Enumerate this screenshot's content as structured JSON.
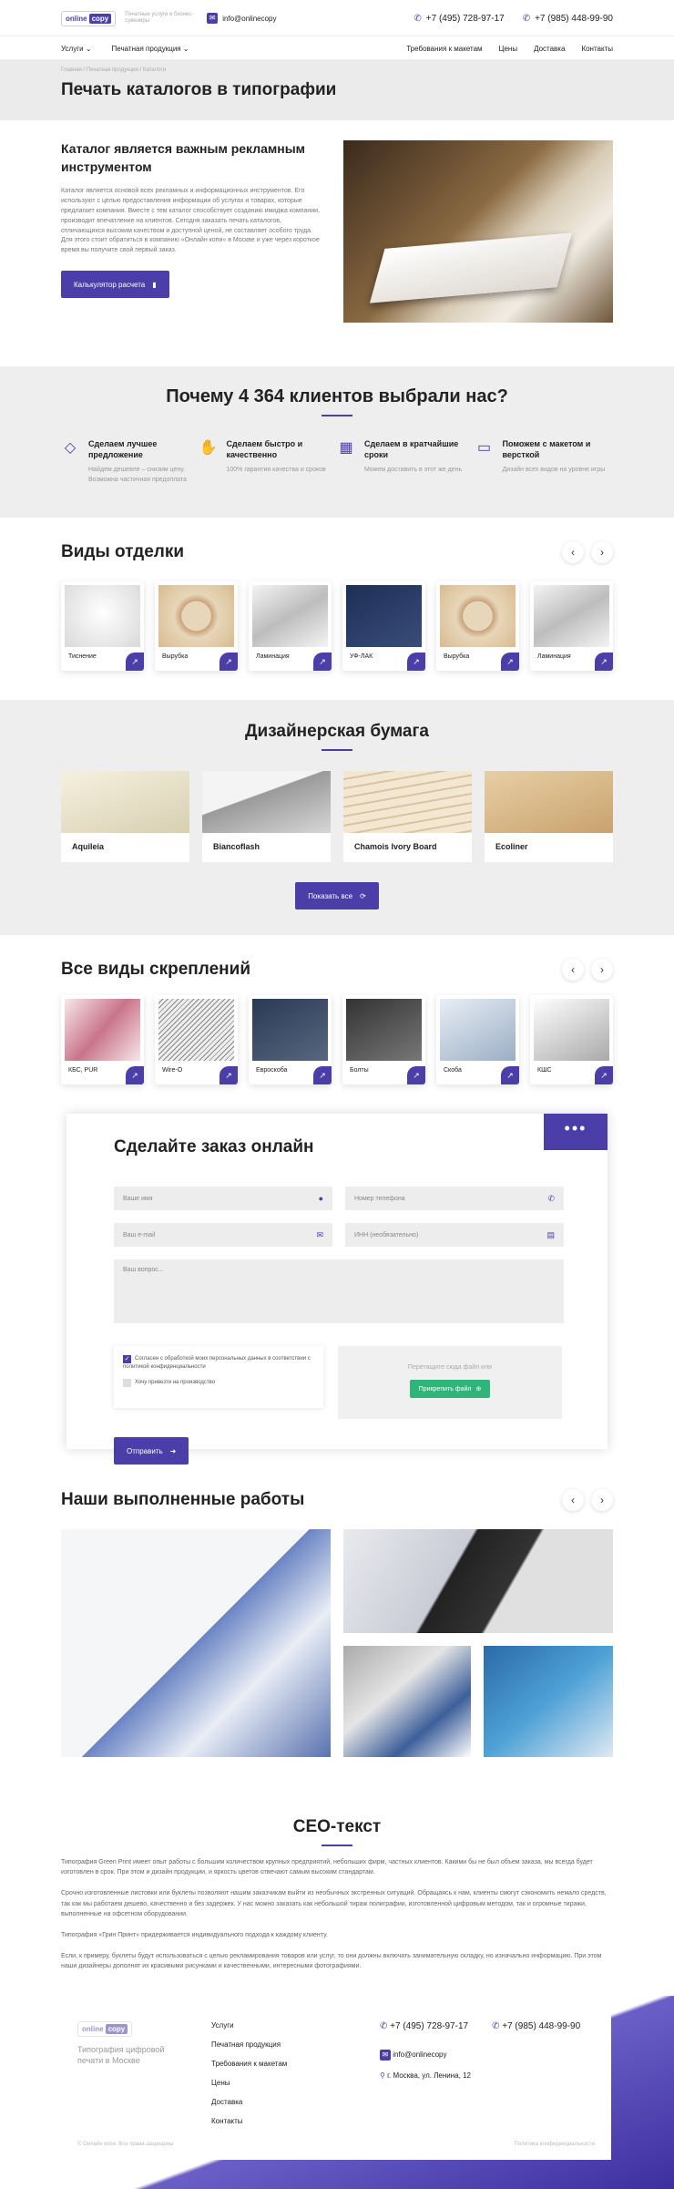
{
  "header": {
    "logo_pre": "online",
    "logo_box": "copy",
    "tagline": "Печатные услуги и бизнес-сувениры",
    "email": "info@onlinecopy",
    "phone1": "+7 (495) 728-97-17",
    "phone2": "+7 (985) 448-99-90"
  },
  "nav": {
    "services": "Услуги",
    "products": "Печатная продукция",
    "items": [
      "Требования к макетам",
      "Цены",
      "Доставка",
      "Контакты"
    ]
  },
  "breadcrumbs": "Главная / Печатная продукция / Каталоги",
  "page_title": "Печать каталогов в типографии",
  "intro": {
    "heading": "Каталог является важным рекламным инструментом",
    "text": "Каталог является основой всех рекламных и информационных инструментов. Его используют с целью предоставления информации об услугах и товарах, которые предлагает компания. Вместе с тем каталог способствует созданию имиджа компании, производит впечатление на клиентов. Сегодня заказать печать каталогов, отличающихся высоким качеством и доступной ценой, не составляет особого труда. Для этого стоит обратиться в компанию «Онлайн копи» в Москве и уже через короткое время вы получите свой первый заказ.",
    "button": "Калькулятор расчета"
  },
  "why": {
    "title": "Почему 4 364 клиентов выбрали нас?",
    "features": [
      {
        "title": "Сделаем лучшее предложение",
        "text": "Найдем дешевле – снизим цену. Возможна частичная предоплата"
      },
      {
        "title": "Сделаем быстро и качественно",
        "text": "100% гарантия качества и сроков"
      },
      {
        "title": "Сделаем в кратчайшие сроки",
        "text": "Можем доставить в этот же день"
      },
      {
        "title": "Поможем с макетом и версткой",
        "text": "Дизайн всех видов на уровне игры"
      }
    ]
  },
  "finishes": {
    "title": "Виды отделки",
    "items": [
      "Тиснение",
      "Вырубка",
      "Ламинация",
      "УФ-ЛАК",
      "Вырубка",
      "Ламинация"
    ]
  },
  "paper": {
    "title": "Дизайнерская бумага",
    "items": [
      "Aquileia",
      "Biancoflash",
      "Chamois Ivory Board",
      "Ecoliner"
    ],
    "button": "Показать все"
  },
  "bindings": {
    "title": "Все виды скреплений",
    "items": [
      "КБС, PUR",
      "Wire-O",
      "Евроскоба",
      "Болты",
      "Скоба",
      "КШС"
    ]
  },
  "order": {
    "title": "Сделайте заказ онлайн",
    "name": "Ваше имя",
    "phone": "Номер телефона",
    "email": "Ваш e-mail",
    "inn": "ИНН (необязательно)",
    "question": "Ваш вопрос...",
    "consent": "Согласен с обработкой моих персональных данных в соответствии с политикой конфиденциальности",
    "urgent": "Хочу привезти на производство",
    "drop": "Перетащите сюда файл или",
    "attach": "Прикрепить файл",
    "send": "Отправить"
  },
  "works": {
    "title": "Наши выполненные работы"
  },
  "seo": {
    "title": "СЕО-текст",
    "p1": "Типография Green Print имеет опыт работы с большим количеством крупных предприятий, небольших фирм, частных клиентов. Какими бы не был объем заказа, мы всегда будет изготовлен в срок. При этом и дизайн продукции, и яркость цветов отвечают самым высоким стандартам.",
    "p2": "Срочно изготовленные листовки или буклеты позволяют нашим заказчикам выйти из необычных экстренных ситуаций. Обращаясь к нам, клиенты смогут сэкономить немало средств, так как мы работаем дешево, качественно и без задержек. У нас можно заказать как небольшой тираж полиграфии, изготовленной цифровым методом, так и огромные тиражи, выполненные на офсетном оборудовании.",
    "p3": "Типография «Грин Принт» придерживается индивидуального подхода к каждому клиенту.",
    "p4": "Если, к примеру, буклеты будут использоваться с целью рекламирования товаров или услуг, то они должны включать занимательную складку, но изначально информацию. При этом наши дизайнеры дополнят их красивыми рисунками и качественными, интересными фотографиями."
  },
  "footer": {
    "tagline": "Типография цифровой печати в Москве",
    "menu": [
      "Услуги",
      "Печатная продукция",
      "Требования к макетам",
      "Цены",
      "Доставка",
      "Контакты"
    ],
    "phone1": "+7 (495) 728-97-17",
    "phone2": "+7 (985) 448-99-90",
    "email": "info@onlinecopy",
    "address": "г. Москва, ул. Ленина, 12",
    "copy": "© Онлайн копи. Все права защищены",
    "policy": "Политика конфиденциальности"
  },
  "colors": {
    "accent": "#4b3ea8",
    "green": "#2fb57a"
  }
}
